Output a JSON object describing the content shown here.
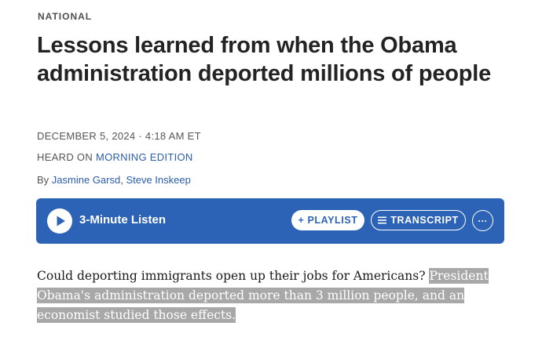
{
  "article": {
    "section": "NATIONAL",
    "headline": "Lessons learned from when the Obama administration deported millions of people",
    "dateline": "DECEMBER 5, 2024 · 4:18 AM ET",
    "heard_prefix": "HEARD ON",
    "heard_program": "MORNING EDITION",
    "byline_prefix": "By",
    "authors": [
      "Jasmine Garsd",
      "Steve Inskeep"
    ],
    "author_separator": ", "
  },
  "player": {
    "listen_label": "3-Minute Listen",
    "playlist_label": "+ PLAYLIST",
    "transcript_label": "TRANSCRIPT",
    "more_label": "···",
    "play_icon": "play-icon",
    "transcript_icon": "list-icon",
    "colors": {
      "bar": "#2d63b6",
      "button_text": "#2d63b6"
    }
  },
  "body": {
    "plain": "Could deporting immigrants open up their jobs for Americans? ",
    "selected": "President Obama's administration deported more than 3 million people, and an economist studied those effects."
  }
}
